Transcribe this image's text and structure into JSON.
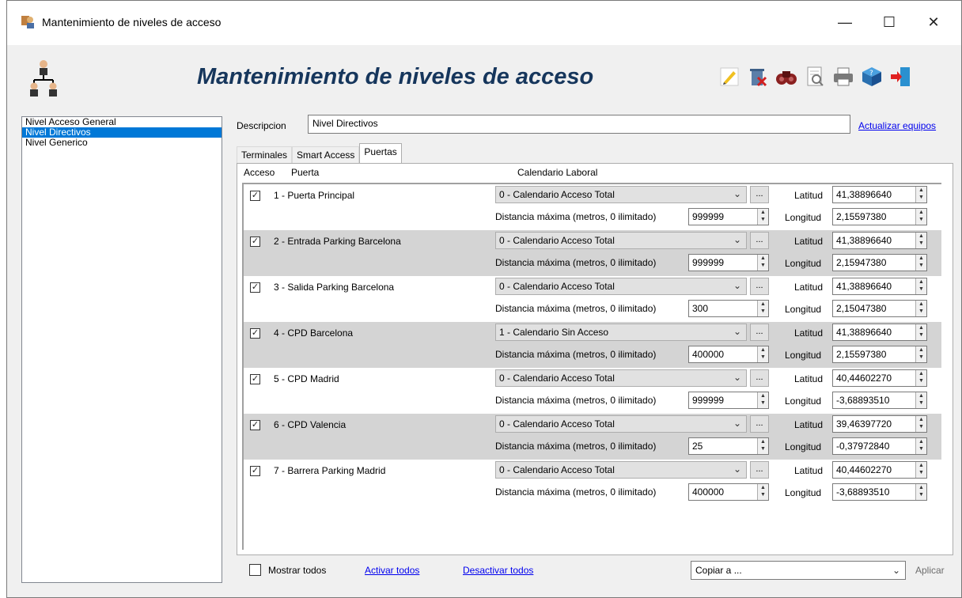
{
  "window": {
    "title": "Mantenimiento de niveles de acceso",
    "minimize": "—",
    "maximize": "☐",
    "close": "✕"
  },
  "header": {
    "title": "Mantenimiento de niveles de acceso",
    "toolbar": [
      "edit-icon",
      "delete-icon",
      "search-icon",
      "preview-icon",
      "print-icon",
      "help-icon",
      "exit-icon"
    ]
  },
  "levels": [
    {
      "label": "Nivel Acceso General",
      "selected": false
    },
    {
      "label": "Nivel Directivos",
      "selected": true
    },
    {
      "label": "Nivel Generico",
      "selected": false
    }
  ],
  "form": {
    "description_label": "Descripcion",
    "description_value": "Nivel Directivos",
    "update_link": "Actualizar equipos"
  },
  "tabs": [
    {
      "label": "Terminales",
      "active": false
    },
    {
      "label": "Smart Access",
      "active": false
    },
    {
      "label": "Puertas",
      "active": true
    }
  ],
  "columns": {
    "access": "Acceso",
    "door": "Puerta",
    "calendar": "Calendario Laboral"
  },
  "labels": {
    "distance": "Distancia máxima (metros, 0 ilimitado)",
    "latitude": "Latitud",
    "longitude": "Longitud",
    "dots": "..."
  },
  "doors": [
    {
      "name": "1 - Puerta Principal",
      "checked": true,
      "calendar": "0 - Calendario Acceso Total",
      "distance": "999999",
      "lat": "41,38896640",
      "lon": "2,15597380",
      "shaded": false
    },
    {
      "name": "2 - Entrada Parking Barcelona",
      "checked": true,
      "calendar": "0 - Calendario Acceso Total",
      "distance": "999999",
      "lat": "41,38896640",
      "lon": "2,15947380",
      "shaded": true
    },
    {
      "name": "3 - Salida Parking Barcelona",
      "checked": true,
      "calendar": "0 - Calendario Acceso Total",
      "distance": "300",
      "lat": "41,38896640",
      "lon": "2,15047380",
      "shaded": false
    },
    {
      "name": "4 - CPD Barcelona",
      "checked": true,
      "calendar": "1 - Calendario Sin Acceso",
      "distance": "400000",
      "lat": "41,38896640",
      "lon": "2,15597380",
      "shaded": true
    },
    {
      "name": "5 - CPD Madrid",
      "checked": true,
      "calendar": "0 - Calendario Acceso Total",
      "distance": "999999",
      "lat": "40,44602270",
      "lon": "-3,68893510",
      "shaded": false
    },
    {
      "name": "6 - CPD Valencia",
      "checked": true,
      "calendar": "0 - Calendario Acceso Total",
      "distance": "25",
      "lat": "39,46397720",
      "lon": "-0,37972840",
      "shaded": true
    },
    {
      "name": "7 - Barrera Parking Madrid",
      "checked": true,
      "calendar": "0 - Calendario Acceso Total",
      "distance": "400000",
      "lat": "40,44602270",
      "lon": "-3,68893510",
      "shaded": false
    }
  ],
  "footer": {
    "show_all_label": "Mostrar todos",
    "show_all_checked": false,
    "activate_all": "Activar todos",
    "deactivate_all": "Desactivar todos",
    "copy_to": "Copiar a ...",
    "apply": "Aplicar"
  }
}
